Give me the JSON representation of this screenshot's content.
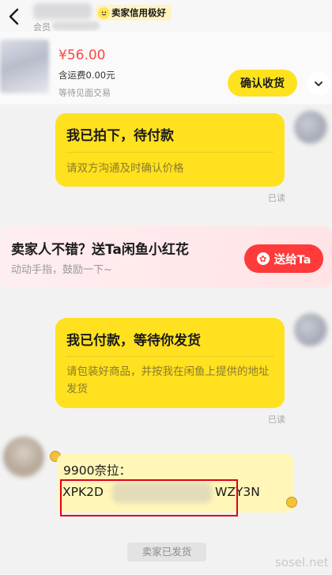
{
  "header": {
    "seller_sub_prefix": "会员",
    "credit_badge": "卖家信用极好"
  },
  "product": {
    "price": "¥56.00",
    "shipping": "含运费0.00元",
    "trade_mode": "等待见面交易",
    "confirm_label": "确认收货"
  },
  "messages": [
    {
      "title": "我已拍下，待付款",
      "subtitle": "请双方沟通及时确认价格",
      "read": "已读"
    },
    {
      "title": "我已付款，等待你发货",
      "subtitle": "请包装好商品，并按我在闲鱼上提供的地址发货",
      "read": "已读"
    }
  ],
  "gift_banner": {
    "title": "卖家人不错？送Ta闲鱼小红花",
    "subtitle": "动动手指，鼓励一下~",
    "button": "送给Ta"
  },
  "code_message": {
    "label": "9900奈拉：",
    "code_start": "XPK2D",
    "code_end": "WZY3N"
  },
  "system_tag": "卖家已发货",
  "watermark": "sosel.net"
}
